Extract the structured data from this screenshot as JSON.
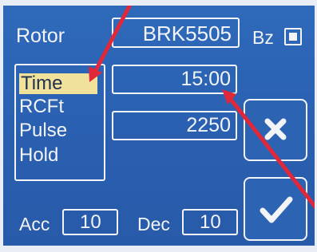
{
  "header": {
    "rotor_label": "Rotor",
    "rotor_value": "BRK5505",
    "bz_label": "Bz",
    "bz_checked": true
  },
  "mode_list": {
    "items": [
      {
        "label": "Time",
        "selected": true
      },
      {
        "label": "RCFt",
        "selected": false
      },
      {
        "label": "Pulse",
        "selected": false
      },
      {
        "label": "Hold",
        "selected": false
      }
    ]
  },
  "fields": {
    "time_value": "15:00",
    "speed_value": "2250"
  },
  "buttons": {
    "cancel_icon": "x-icon",
    "confirm_icon": "checkmark-icon"
  },
  "footer": {
    "acc_label": "Acc",
    "acc_value": "10",
    "dec_label": "Dec",
    "dec_value": "10"
  },
  "colors": {
    "background": "#2b63b3",
    "selection": "#f0e29a",
    "foreground": "#f2f4f8",
    "annotation_arrow": "#e0283a"
  }
}
